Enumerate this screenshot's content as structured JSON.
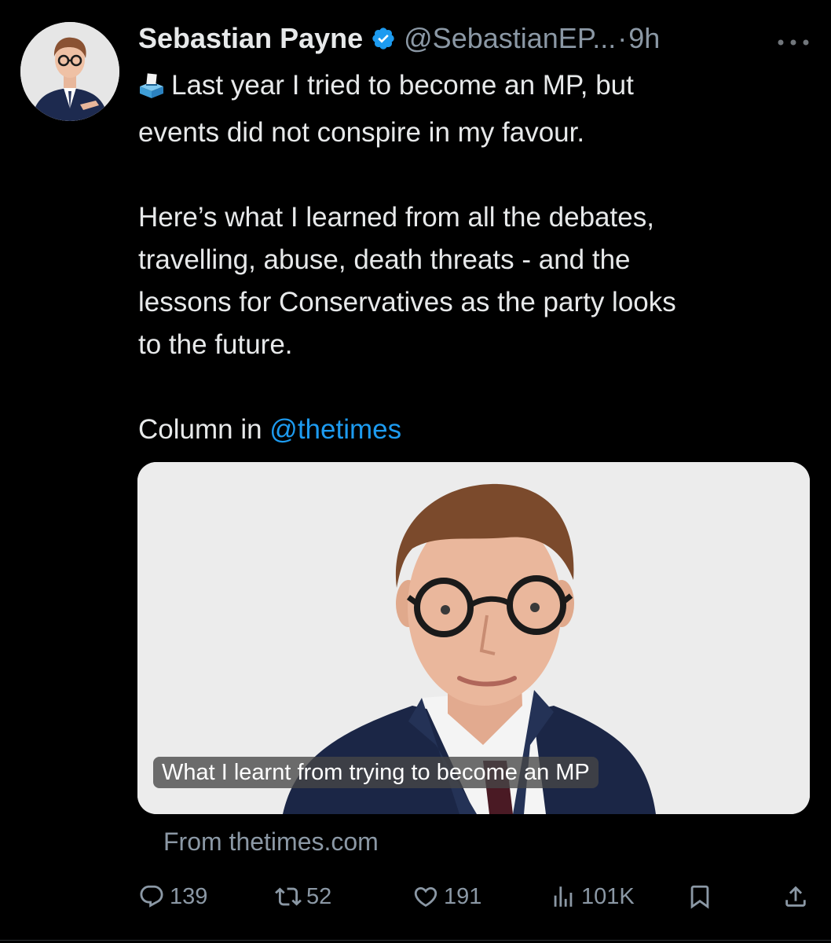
{
  "author": {
    "name": "Sebastian Payne",
    "handle": "@SebastianEP...",
    "separator": "·",
    "time": "9h"
  },
  "tweet": {
    "line1": "Last year I tried to become an MP, but",
    "line2": "events did not conspire in my favour.",
    "paragraph2": "Here’s what I learned from all the debates,\ntravelling, abuse, death threats - and the\nlessons for Conservatives as the party looks\nto the future.",
    "column_prefix": "Column in ",
    "mention": "@thetimes"
  },
  "card": {
    "title": "What I learnt from trying to become an MP",
    "source": "From thetimes.com"
  },
  "actions": {
    "replies": "139",
    "reposts": "52",
    "likes": "191",
    "views": "101K"
  },
  "icons": {
    "verified": "verified-badge-icon",
    "ballot": "ballot-box-icon",
    "more": "more-icon",
    "reply": "reply-icon",
    "repost": "repost-icon",
    "like": "like-icon",
    "views": "views-icon",
    "bookmark": "bookmark-icon",
    "share": "share-icon"
  },
  "colors": {
    "background": "#000000",
    "text": "#e7e9ea",
    "secondary": "#8b98a5",
    "link": "#1d9bf0",
    "verified": "#1d9bf0"
  }
}
